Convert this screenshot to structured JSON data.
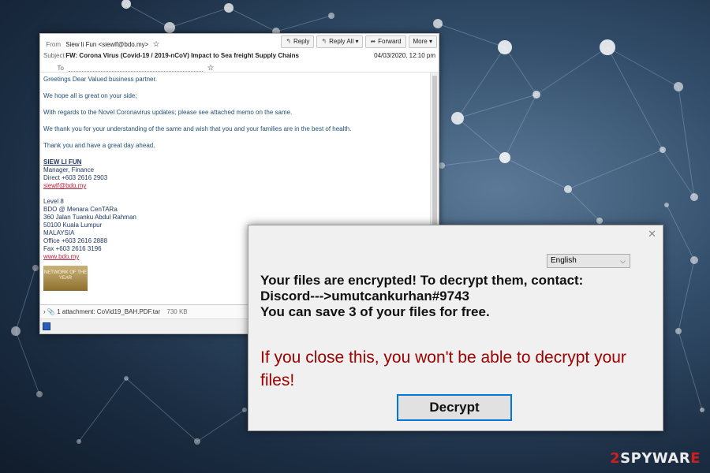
{
  "email": {
    "from_label": "From",
    "from_value": "Siew li Fun <siewlf@bdo.my>",
    "subject_label": "Subject",
    "subject_value": "FW: Corona Virus (Covid-19 / 2019-nCoV) Impact to Sea freight Supply Chains",
    "to_label": "To",
    "date": "04/03/2020, 12:10 pm",
    "toolbar": {
      "reply": "Reply",
      "reply_all": "Reply All",
      "forward": "Forward",
      "more": "More"
    },
    "body": [
      "Greetings Dear Valued business partner.",
      "We hope all is great on your side;",
      "With regards to the Novel Coronavirus updates; please see attached memo on the same.",
      "We thank you for your understanding of the same and wish that you and your families are in the best of health.",
      "Thank you and have a great day ahead."
    ],
    "signature": {
      "name": "SIEW LI FUN",
      "title": "Manager, Finance",
      "direct": "Direct +603 2616 2903",
      "email": "siewlf@bdo.my",
      "address": [
        "Level 8",
        "BDO @ Menara CenTARa",
        "360 Jalan Tuanku Abdul Rahman",
        "50100 Kuala Lumpur",
        "MALAYSIA"
      ],
      "office": "Office +603 2616 2888",
      "fax": "Fax +603 2616 3196",
      "website": "www.bdo.my",
      "award": "NETWORK OF THE YEAR"
    },
    "attachment": {
      "label": "1 attachment: CoVid19_BAH.PDF.tar",
      "size": "730 KB"
    }
  },
  "dialog": {
    "language": "English",
    "message_lines": [
      "Your files are encrypted! To decrypt them, contact:",
      "Discord--->umutcankurhan#9743",
      "You can save 3 of your files for free."
    ],
    "warning": "If you close this, you won't be able to decrypt your files!",
    "decrypt_button": "Decrypt",
    "warning_color": "#a00000",
    "button_border_color": "#0078d7"
  },
  "watermark": {
    "number": "2",
    "text": "SPYWAR",
    "suffix": "E"
  }
}
